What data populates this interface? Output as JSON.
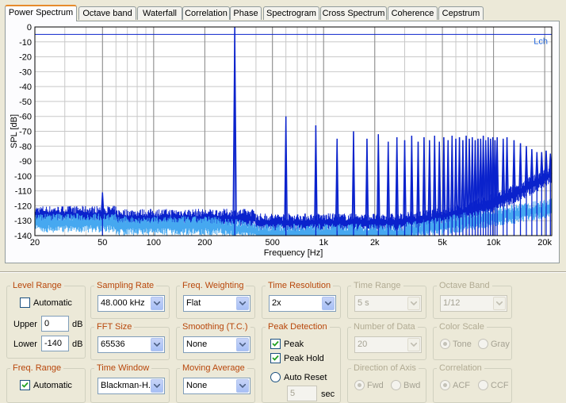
{
  "tabs": [
    {
      "label": "Power Spectrum"
    },
    {
      "label": "Octave band"
    },
    {
      "label": "Waterfall"
    },
    {
      "label": "Correlation"
    },
    {
      "label": "Phase"
    },
    {
      "label": "Spectrogram"
    },
    {
      "label": "Cross Spectrum"
    },
    {
      "label": "Coherence"
    },
    {
      "label": "Cepstrum"
    }
  ],
  "chart_data": {
    "type": "line",
    "xlabel": "Frequency [Hz]",
    "ylabel": "SPL [dB]",
    "xscale": "log",
    "xlim": [
      20,
      22000
    ],
    "ylim": [
      -140,
      0
    ],
    "xticks": [
      "20",
      "50",
      "100",
      "200",
      "500",
      "1k",
      "2k",
      "5k",
      "10k",
      "20k"
    ],
    "yticks": [
      "0",
      "-10",
      "-20",
      "-30",
      "-40",
      "-50",
      "-60",
      "-70",
      "-80",
      "-90",
      "-100",
      "-110",
      "-120",
      "-130",
      "-140"
    ],
    "grid": true,
    "legend_position": "top-right",
    "reference_line": {
      "label": "Lch",
      "y": -5
    },
    "series": [
      {
        "color": "#0a22cc",
        "peaks": [
          {
            "x": 50,
            "y": -111
          },
          {
            "x": 300,
            "y": 0
          },
          {
            "x": 600,
            "y": -60
          },
          {
            "x": 900,
            "y": -66
          },
          {
            "x": 1200,
            "y": -75
          },
          {
            "x": 1500,
            "y": -70
          },
          {
            "x": 1800,
            "y": -75
          },
          {
            "x": 2100,
            "y": -72
          },
          {
            "x": 2400,
            "y": -77
          },
          {
            "x": 2700,
            "y": -74
          },
          {
            "x": 3000,
            "y": -76
          },
          {
            "x": 3300,
            "y": -73
          },
          {
            "x": 3600,
            "y": -77
          },
          {
            "x": 3900,
            "y": -74
          },
          {
            "x": 4200,
            "y": -76
          },
          {
            "x": 4500,
            "y": -73
          },
          {
            "x": 4800,
            "y": -77
          },
          {
            "x": 5100,
            "y": -74
          },
          {
            "x": 5400,
            "y": -76
          },
          {
            "x": 5700,
            "y": -73
          },
          {
            "x": 6000,
            "y": -75
          },
          {
            "x": 6300,
            "y": -74
          },
          {
            "x": 6600,
            "y": -76
          },
          {
            "x": 6900,
            "y": -73
          },
          {
            "x": 7200,
            "y": -75
          },
          {
            "x": 7500,
            "y": -74
          },
          {
            "x": 7800,
            "y": -76
          },
          {
            "x": 8100,
            "y": -75
          },
          {
            "x": 8400,
            "y": -75
          },
          {
            "x": 8700,
            "y": -73
          },
          {
            "x": 9000,
            "y": -76
          },
          {
            "x": 9300,
            "y": -74
          },
          {
            "x": 9600,
            "y": -75
          },
          {
            "x": 9900,
            "y": -74
          },
          {
            "x": 10200,
            "y": -76
          },
          {
            "x": 10500,
            "y": -74
          },
          {
            "x": 11400,
            "y": -75
          },
          {
            "x": 12000,
            "y": -74
          },
          {
            "x": 13200,
            "y": -76
          },
          {
            "x": 14400,
            "y": -78
          },
          {
            "x": 15600,
            "y": -80
          },
          {
            "x": 16800,
            "y": -82
          },
          {
            "x": 18000,
            "y": -84
          },
          {
            "x": 19200,
            "y": -84
          },
          {
            "x": 20400,
            "y": -83
          },
          {
            "x": 21600,
            "y": -85
          }
        ]
      },
      {
        "color": "#46a8f0"
      }
    ]
  },
  "controls": {
    "level_range": {
      "title": "Level Range",
      "automatic_label": "Automatic",
      "automatic_checked": false,
      "upper_label": "Upper",
      "upper_value": "0",
      "upper_unit": "dB",
      "lower_label": "Lower",
      "lower_value": "-140",
      "lower_unit": "dB"
    },
    "freq_range": {
      "title": "Freq. Range",
      "automatic_label": "Automatic",
      "automatic_checked": true
    },
    "sampling_rate": {
      "title": "Sampling Rate",
      "value": "48.000 kHz"
    },
    "fft_size": {
      "title": "FFT Size",
      "value": "65536"
    },
    "time_window": {
      "title": "Time Window",
      "value": "Blackman-H..."
    },
    "freq_weighting": {
      "title": "Freq. Weighting",
      "value": "Flat"
    },
    "smoothing": {
      "title": "Smoothing (T.C.)",
      "value": "None"
    },
    "moving_average": {
      "title": "Moving Average",
      "value": "None"
    },
    "time_resolution": {
      "title": "Time Resolution",
      "value": "2x"
    },
    "peak_detection": {
      "title": "Peak Detection",
      "peak_label": "Peak",
      "peak_checked": true,
      "peak_hold_label": "Peak Hold",
      "peak_hold_checked": true,
      "auto_reset_label": "Auto Reset",
      "auto_reset_value": "5",
      "auto_reset_unit": "sec"
    },
    "time_range": {
      "title": "Time Range",
      "value": "5 s"
    },
    "number_of_data": {
      "title": "Number of Data",
      "value": "20"
    },
    "direction_of_axis": {
      "title": "Direction of Axis",
      "fwd_label": "Fwd",
      "bwd_label": "Bwd"
    },
    "octave_band": {
      "title": "Octave Band",
      "value": "1/12"
    },
    "color_scale": {
      "title": "Color Scale",
      "tone_label": "Tone",
      "gray_label": "Gray"
    },
    "correlation": {
      "title": "Correlation",
      "acf_label": "ACF",
      "ccf_label": "CCF"
    }
  },
  "colors": {
    "accent_label": "#b8460a",
    "disabled_label": "#b1ab93",
    "tab_highlight": "#e68b2c",
    "plot_dark": "#0a22cc",
    "plot_light": "#46a8f0"
  }
}
